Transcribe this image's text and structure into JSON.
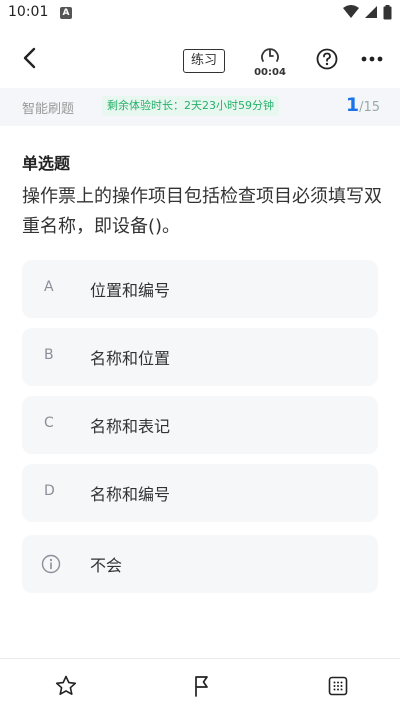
{
  "status_bar": {
    "time": "10:01",
    "app_badge": "A",
    "icons": [
      "wifi-icon",
      "signal-icon",
      "battery-icon"
    ]
  },
  "header": {
    "back_icon": "back-arrow-icon",
    "practice_label": "练习",
    "timer_text": "00:04",
    "help_icon": "question-icon",
    "more_icon": "more-icon"
  },
  "info_bar": {
    "mode_label": "智能刷题",
    "trial_text": "剩余体验时长：2天23小时59分钟",
    "current": "1",
    "total": "/15"
  },
  "question": {
    "type": "单选题",
    "text": "操作票上的操作项目包括检查项目必须填写双重名称，即设备()。",
    "options": [
      {
        "letter": "A",
        "text": "位置和编号"
      },
      {
        "letter": "B",
        "text": "名称和位置"
      },
      {
        "letter": "C",
        "text": "名称和表记"
      },
      {
        "letter": "D",
        "text": "名称和编号"
      }
    ],
    "dont_know": {
      "icon": "info-circle-icon",
      "text": "不会"
    }
  },
  "bottom_bar": {
    "icons": [
      "star-icon",
      "flag-icon",
      "answer-sheet-icon"
    ]
  },
  "colors": {
    "accent": "#1a73e8",
    "trial_green": "#27b06b",
    "trial_bg": "#e8f7ef",
    "option_bg": "#f6f7f9",
    "info_bg": "#f4f6f9"
  }
}
